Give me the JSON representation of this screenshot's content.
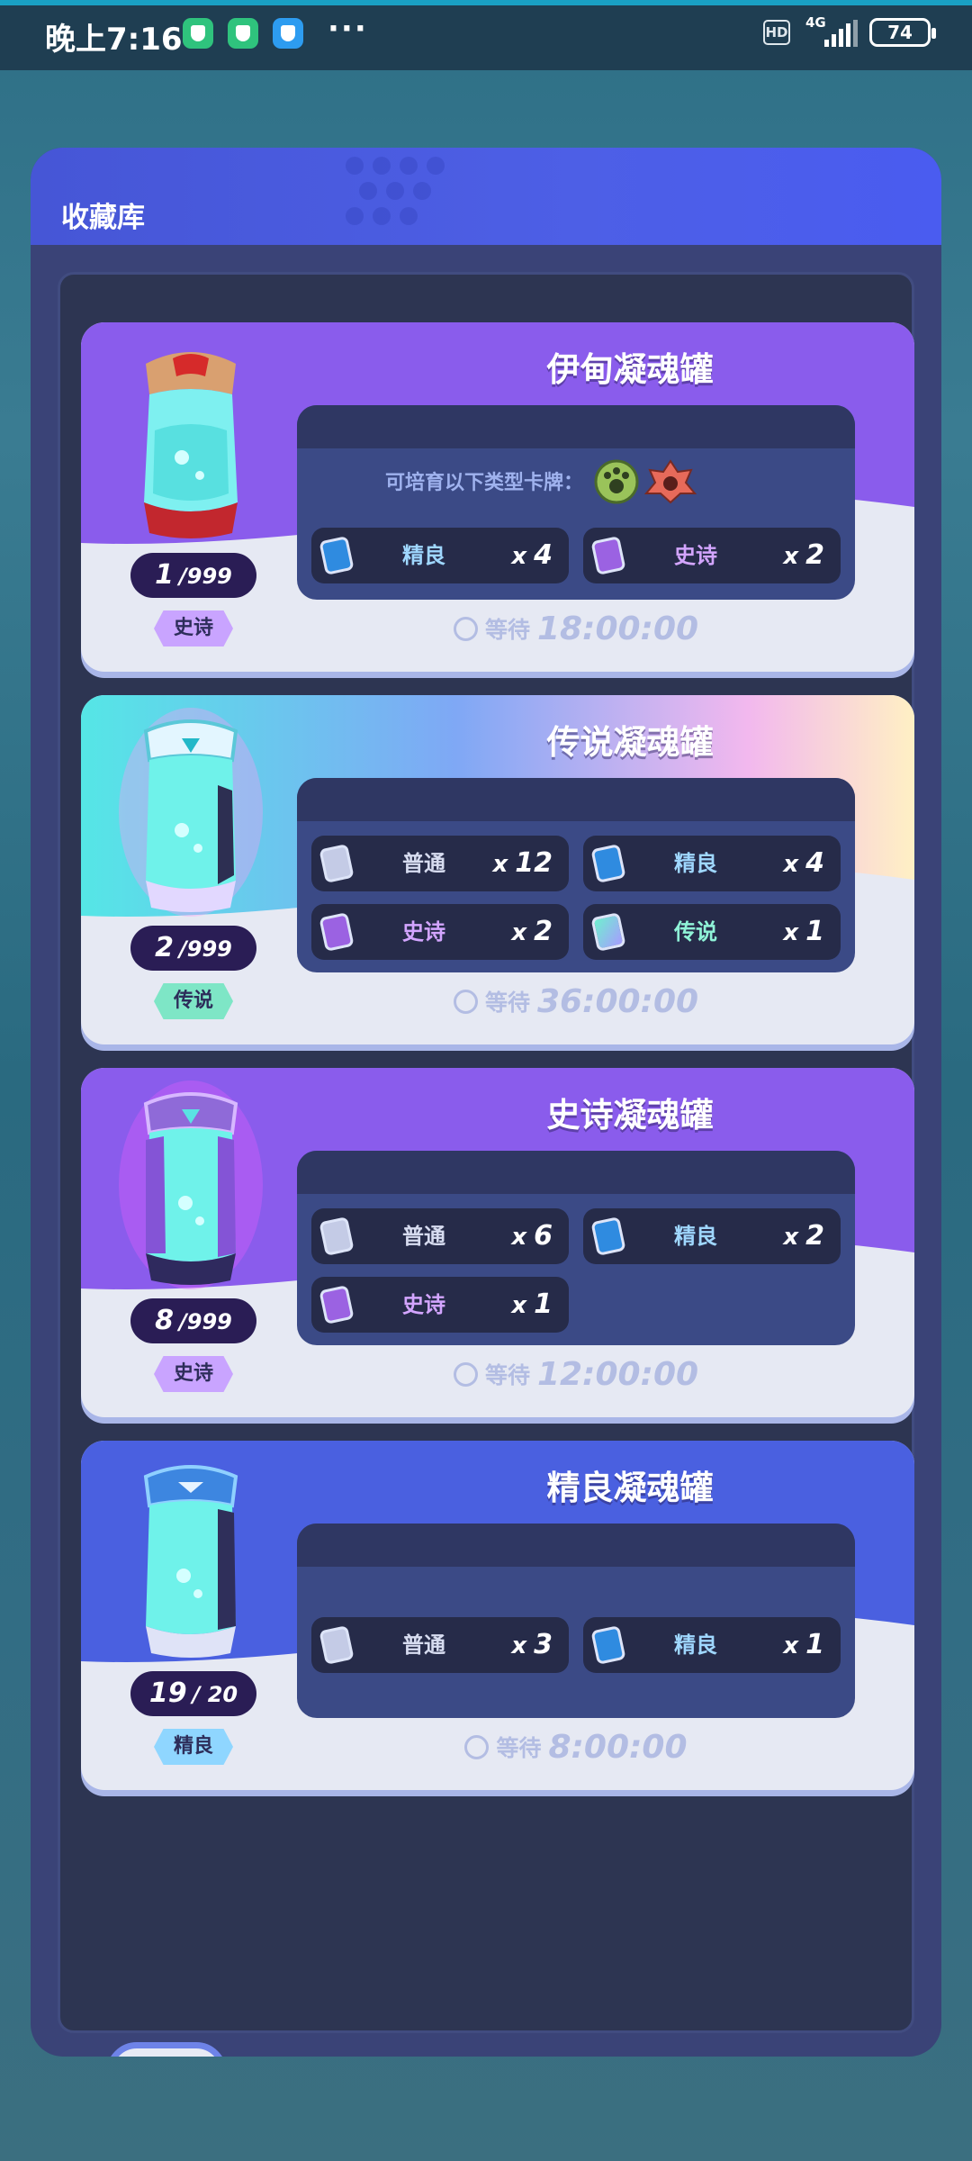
{
  "status_bar": {
    "time": "晚上7:16",
    "more": "···",
    "hd": "HD",
    "network": "4G",
    "battery": "74"
  },
  "panel": {
    "title": "收藏库"
  },
  "cards": [
    {
      "name": "伊甸凝魂罐",
      "count": "1",
      "max": "/999",
      "rarity": "史诗",
      "breed_text": "可培育以下类型卡牌：",
      "items": [
        {
          "type": "fine",
          "label": "精良",
          "x": "x",
          "qty": "4"
        },
        {
          "type": "epic",
          "label": "史诗",
          "x": "x",
          "qty": "2"
        }
      ],
      "wait_label": "等待",
      "wait_time": "18:00:00"
    },
    {
      "name": "传说凝魂罐",
      "count": "2",
      "max": "/999",
      "rarity": "传说",
      "items": [
        {
          "type": "common",
          "label": "普通",
          "x": "x",
          "qty": "12"
        },
        {
          "type": "fine",
          "label": "精良",
          "x": "x",
          "qty": "4"
        },
        {
          "type": "epic",
          "label": "史诗",
          "x": "x",
          "qty": "2"
        },
        {
          "type": "legend",
          "label": "传说",
          "x": "x",
          "qty": "1"
        }
      ],
      "wait_label": "等待",
      "wait_time": "36:00:00"
    },
    {
      "name": "史诗凝魂罐",
      "count": "8",
      "max": "/999",
      "rarity": "史诗",
      "items": [
        {
          "type": "common",
          "label": "普通",
          "x": "x",
          "qty": "6"
        },
        {
          "type": "fine",
          "label": "精良",
          "x": "x",
          "qty": "2"
        },
        {
          "type": "epic",
          "label": "史诗",
          "x": "x",
          "qty": "1"
        }
      ],
      "wait_label": "等待",
      "wait_time": "12:00:00"
    },
    {
      "name": "精良凝魂罐",
      "count": "19",
      "max": "/ 20",
      "rarity": "精良",
      "items": [
        {
          "type": "common",
          "label": "普通",
          "x": "x",
          "qty": "3"
        },
        {
          "type": "fine",
          "label": "精良",
          "x": "x",
          "qty": "1"
        }
      ],
      "wait_label": "等待",
      "wait_time": "8:00:00"
    }
  ],
  "colors": {
    "panel": "#3a4377",
    "header": "#4a5cf0",
    "epic": "#8b5cf0",
    "legend": "#7ee6d0",
    "fine": "#4a60e0"
  }
}
